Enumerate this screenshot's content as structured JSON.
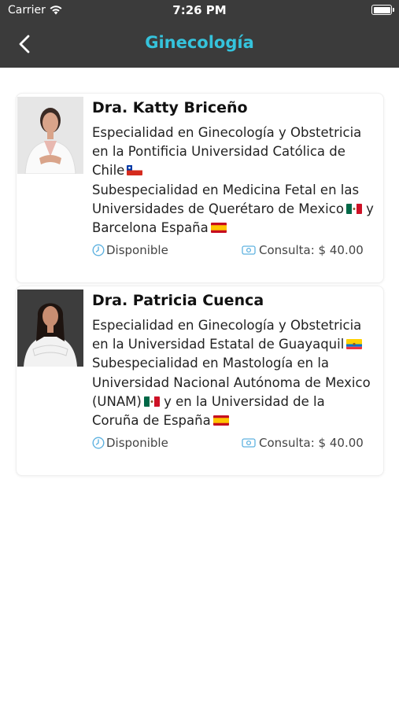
{
  "status_bar": {
    "carrier": "Carrier",
    "time": "7:26 PM"
  },
  "header": {
    "title": "Ginecología"
  },
  "colors": {
    "header_bg": "#3b3b3b",
    "accent": "#35c3dc",
    "icon_blue": "#5fb2e0"
  },
  "doctors": [
    {
      "name": "Dra. Katty Briceño",
      "lines": [
        "Especialidad en Ginecología y Obstetricia",
        "en la Pontificia Universidad Católica de",
        "Chile",
        "Subespecialidad en Medicina Fetal en las",
        "Universidades de Querétaro de Mexico",
        "Barcelona España"
      ],
      "connector": "y",
      "status": "Disponible",
      "fee": "Consulta: $ 40.00",
      "flags": [
        "chile-flag",
        "mexico-flag",
        "spain-flag"
      ]
    },
    {
      "name": "Dra. Patricia Cuenca",
      "lines": [
        "Especialidad en Ginecología y Obstetricia",
        "en la Universidad Estatal de Guayaquil",
        "Subespecialidad en Mastología en la",
        "Universidad Nacional Autónoma de Mexico",
        "(UNAM)",
        "y en la Universidad de la",
        "Coruña de España"
      ],
      "status": "Disponible",
      "fee": "Consulta: $ 40.00",
      "flags": [
        "ecuador-flag",
        "mexico-flag",
        "spain-flag"
      ]
    }
  ]
}
